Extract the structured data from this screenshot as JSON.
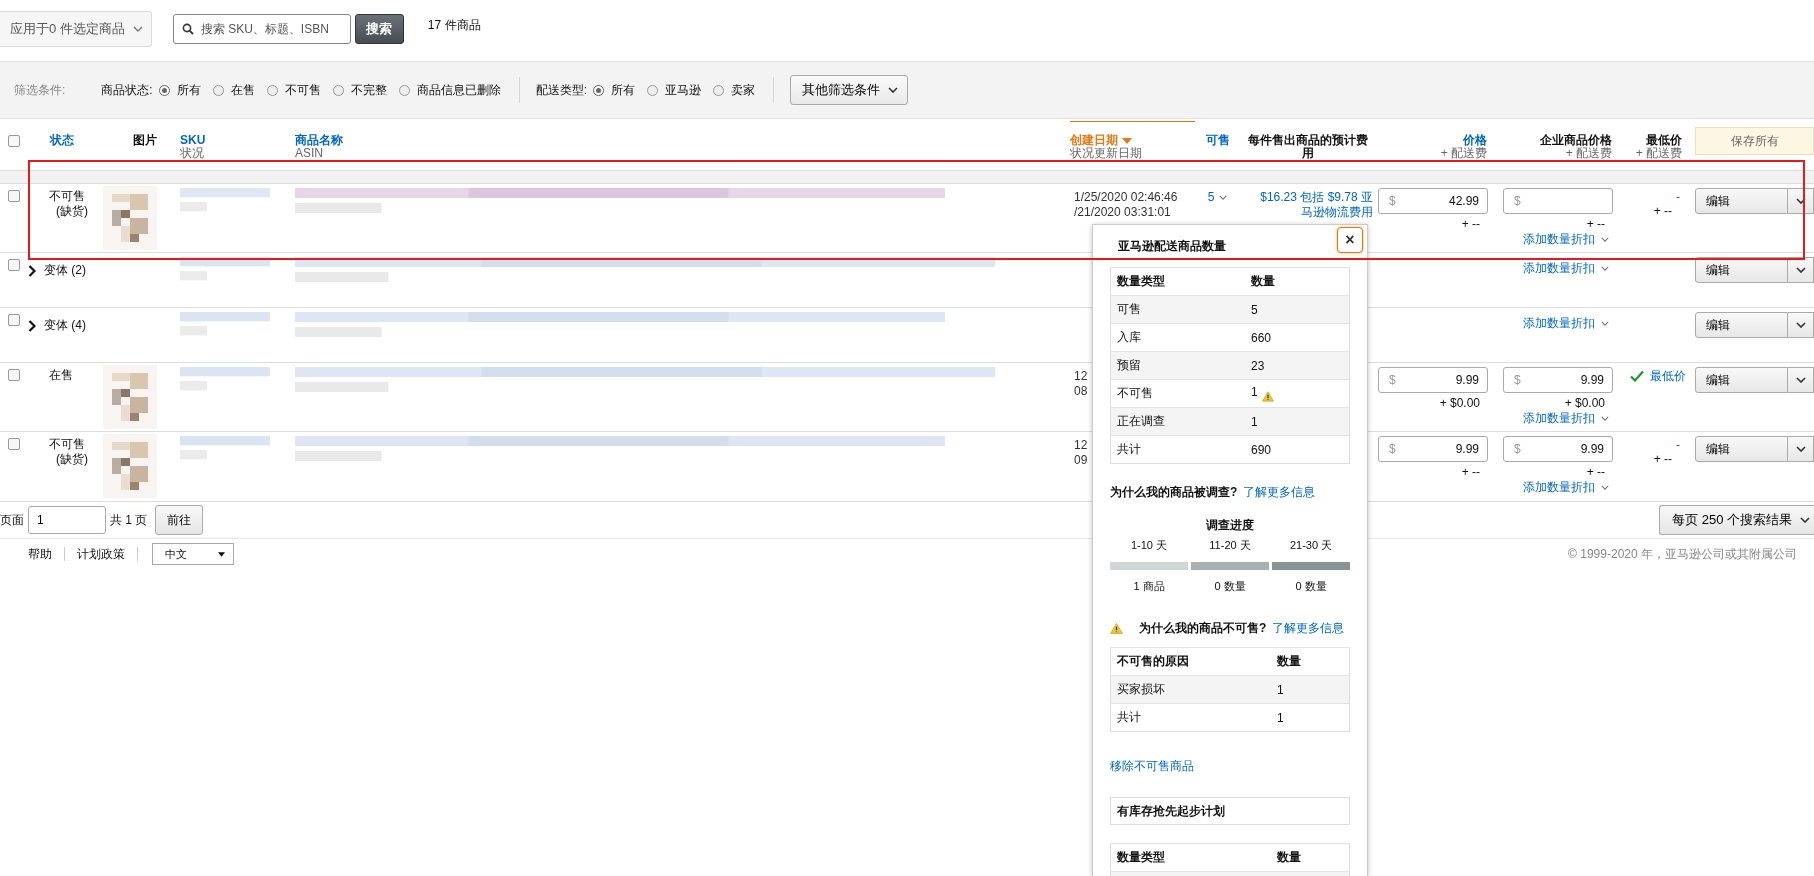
{
  "toolbar": {
    "bulk_action": "应用于0 件选定商品",
    "search": {
      "placeholder": "搜索 SKU、标题、ISBN"
    },
    "search_button": "搜索",
    "count": "17 件商品"
  },
  "filters": {
    "label": "筛选条件:",
    "groups": [
      {
        "label": "商品状态:",
        "options": [
          {
            "label": "所有",
            "selected": true
          },
          {
            "label": "在售",
            "selected": false
          },
          {
            "label": "不可售",
            "selected": false
          },
          {
            "label": "不完整",
            "selected": false
          },
          {
            "label": "商品信息已删除",
            "selected": false
          }
        ]
      },
      {
        "label": "配送类型:",
        "options": [
          {
            "label": "所有",
            "selected": true
          },
          {
            "label": "亚马逊",
            "selected": false
          },
          {
            "label": "卖家",
            "selected": false
          }
        ]
      }
    ],
    "more_button": "其他筛选条件"
  },
  "table": {
    "select_all": {
      "checked": false
    },
    "columns": [
      {
        "kind": "sort",
        "label": "状态",
        "sorted": false
      },
      {
        "kind": "plain",
        "label": "图片"
      },
      {
        "kind": "sort",
        "label": "SKU",
        "sublabel": "状况",
        "sorted": false
      },
      {
        "kind": "sort",
        "label": "商品名称",
        "sublabel": "ASIN",
        "sorted": false
      },
      {
        "kind": "sort",
        "label": "创建日期",
        "sublabel": "状况更新日期",
        "sorted": true
      },
      {
        "kind": "sort",
        "label": "可售",
        "sorted": false
      },
      {
        "kind": "plain",
        "label": "每件售出商品的预计费用"
      },
      {
        "kind": "sort",
        "label": "价格",
        "sublabel": "+ 配送费",
        "sorted": false
      },
      {
        "kind": "plain",
        "label": "企业商品价格",
        "sublabel": "+ 配送费"
      },
      {
        "kind": "plain",
        "label": "最低价",
        "sublabel": "+ 配送费"
      },
      {
        "kind": "button",
        "label": "保存所有"
      }
    ],
    "rows": [
      {
        "kind": "item",
        "checked": false,
        "status": "不可售",
        "status_note": "(缺货)",
        "created": "1/25/2020 02:46:46",
        "updated": "/21/2020 03:31:01",
        "available": "5",
        "fee": "$16.23 包括 $9.78 亚马逊物流费用",
        "price": {
          "currency": "$",
          "value": "42.99",
          "shipping": "+ --"
        },
        "business_price": {
          "currency": "$",
          "shipping": "+ --"
        },
        "discount_link": "添加数量折扣",
        "lowest": {
          "kind": "dash",
          "value": "-",
          "shipping": "+ --"
        },
        "action": "编辑"
      },
      {
        "kind": "variant_group",
        "checked": false,
        "status": "变体 (2)",
        "discount_link": "添加数量折扣",
        "action": "编辑"
      },
      {
        "kind": "variant_group",
        "checked": false,
        "status": "变体 (4)",
        "discount_link": "添加数量折扣",
        "action": "编辑"
      },
      {
        "kind": "item",
        "checked": false,
        "status": "在售",
        "created": "12",
        "updated": "08",
        "price": {
          "currency": "$",
          "value": "9.99",
          "shipping": "+ $0.00"
        },
        "business_price": {
          "currency": "$",
          "value": "9.99",
          "shipping": "+ $0.00"
        },
        "discount_link": "添加数量折扣",
        "lowest": {
          "kind": "winner",
          "label": "最低价"
        },
        "action": "编辑"
      },
      {
        "kind": "item",
        "checked": false,
        "status": "不可售",
        "status_note": "(缺货)",
        "created": "12",
        "updated": "09",
        "price": {
          "currency": "$",
          "value": "9.99",
          "shipping": "+ --"
        },
        "business_price": {
          "currency": "$",
          "value": "9.99",
          "shipping": "+ --"
        },
        "discount_link": "添加数量折扣",
        "lowest": {
          "kind": "dash",
          "value": "-",
          "shipping": "+ --"
        },
        "action": "编辑"
      }
    ]
  },
  "pagination": {
    "page_label": "页面",
    "page": "1",
    "total": "共 1 页",
    "go_button": "前往",
    "per_page": "每页 250 个搜索结果"
  },
  "footer": {
    "links": [
      "帮助",
      "计划政策"
    ],
    "language": "中文",
    "copyright": "© 1999-2020 年，亚马逊公司或其附属公司"
  },
  "popup": {
    "title": "亚马逊配送商品数量",
    "close": "×",
    "inventory_table": {
      "columns": [
        "数量类型",
        "数量"
      ],
      "rows": [
        {
          "type": "可售",
          "qty": "5",
          "warning": false
        },
        {
          "type": "入库",
          "qty": "660",
          "warning": false
        },
        {
          "type": "预留",
          "qty": "23",
          "warning": false
        },
        {
          "type": "不可售",
          "qty": "1",
          "warning": true
        },
        {
          "type": "正在调查",
          "qty": "1",
          "warning": false
        },
        {
          "type": "共计",
          "qty": "690",
          "warning": false
        }
      ]
    },
    "investigation": {
      "question": "为什么我的商品被调查?",
      "link": "了解更多信息"
    },
    "progress": {
      "title": "调查进度",
      "stages": [
        {
          "range": "1-10 天",
          "count": "1 商品",
          "color": "#cfd6d6"
        },
        {
          "range": "11-20 天",
          "count": "0 数量",
          "color": "#a6b2b2"
        },
        {
          "range": "21-30 天",
          "count": "0 数量",
          "color": "#879494"
        }
      ]
    },
    "unfulfillable": {
      "question": "为什么我的商品不可售?",
      "link": "了解更多信息",
      "warning": true
    },
    "reason_table": {
      "columns": [
        "不可售的原因",
        "数量"
      ],
      "rows": [
        {
          "reason": "买家损坏",
          "qty": "1"
        },
        {
          "reason": "共计",
          "qty": "1"
        }
      ]
    },
    "remove_link": "移除不可售商品",
    "program_title": "有库存抢先起步计划",
    "program_table": {
      "columns": [
        "数量类型",
        "数量"
      ]
    }
  },
  "highlight": {
    "kind": "frame"
  }
}
